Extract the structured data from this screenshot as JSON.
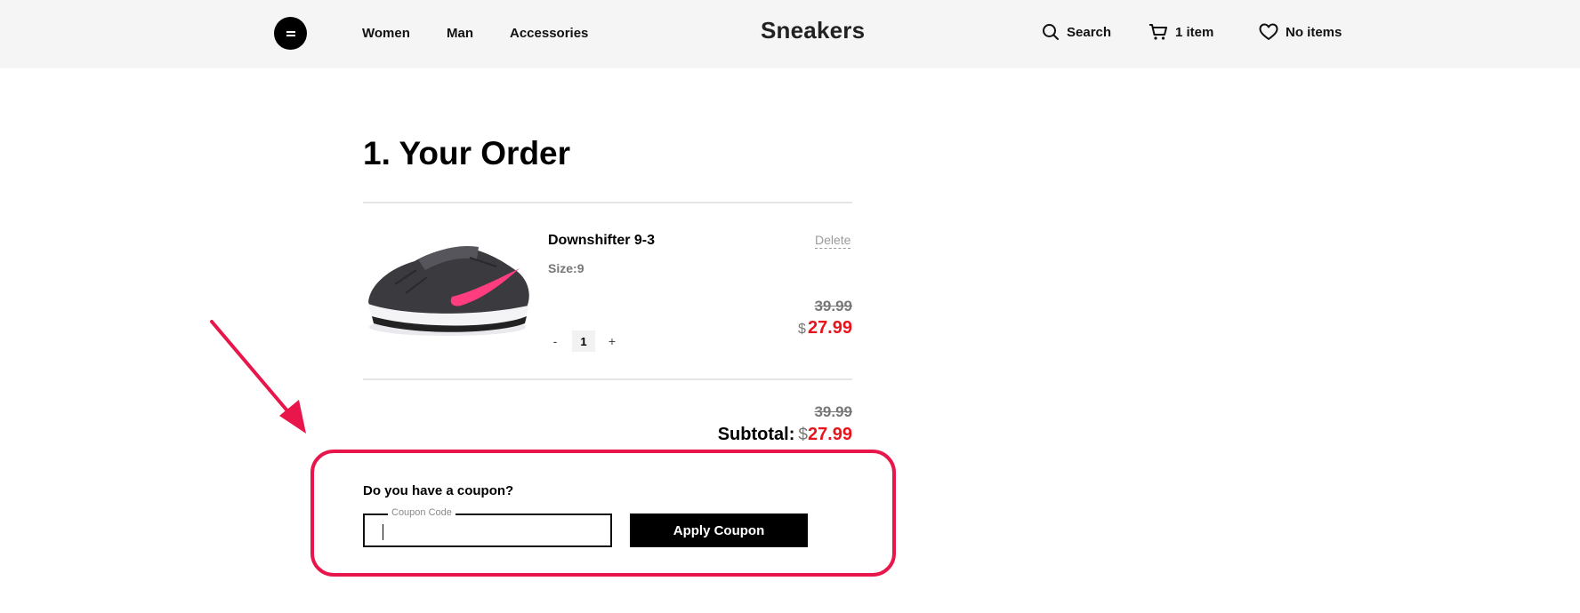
{
  "header": {
    "brand": "Sneakers",
    "nav": [
      "Women",
      "Man",
      "Accessories"
    ],
    "search_label": "Search",
    "cart_label": "1 item",
    "wishlist_label": "No items",
    "icons": {
      "menu": "menu-icon",
      "search": "search-icon",
      "cart": "cart-icon",
      "wishlist": "heart-icon"
    }
  },
  "order": {
    "title": "1. Your Order",
    "item": {
      "name": "Downshifter 9-3",
      "size_label": "Size:",
      "size_value": "9",
      "delete_label": "Delete",
      "old_price": "39.99",
      "currency": "$",
      "new_price": "27.99",
      "quantity": "1",
      "qty_minus": "-",
      "qty_plus": "+"
    },
    "summary": {
      "old_price": "39.99",
      "subtotal_label": "Subtotal:",
      "currency": "$",
      "subtotal_price": "27.99"
    }
  },
  "coupon": {
    "question": "Do you have a coupon?",
    "field_label": "Coupon Code",
    "field_value": "",
    "apply_label": "Apply Coupon"
  },
  "colors": {
    "accent": "#e8164a",
    "price": "#e8141c",
    "header_bg": "#f5f5f5"
  }
}
